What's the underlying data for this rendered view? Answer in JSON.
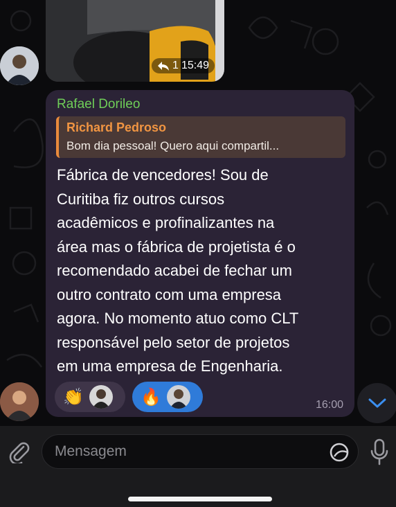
{
  "previous_message": {
    "time": "15:49",
    "forward_count": "1"
  },
  "message": {
    "sender": "Rafael Dorileo",
    "reply_to": {
      "author": "Richard Pedroso",
      "snippet": "Bom dia pessoal! Quero aqui compartil..."
    },
    "lines": [
      "Fábrica de vencedores!  Sou de",
      "Curitiba fiz outros cursos",
      "acadêmicos e profinalizantes na",
      "área mas o fábrica de projetista é o",
      "recomendado acabei de fechar um",
      "outro contrato com uma empresa",
      "agora. No momento atuo como CLT",
      "responsável pelo setor de projetos",
      "em uma empresa de Engenharia."
    ],
    "time": "16:00",
    "reactions": [
      {
        "emoji": "👏",
        "selected": false
      },
      {
        "emoji": "🔥",
        "selected": true
      }
    ]
  },
  "composer": {
    "placeholder": "Mensagem"
  },
  "colors": {
    "sender": "#6fce58",
    "reply_author": "#f19542",
    "bubble": "#2b2336",
    "selected_reaction": "#2f7bd9"
  },
  "icons": [
    "attach-icon",
    "sticker-icon",
    "mic-icon",
    "chevron-down-icon",
    "reply-forward-icon"
  ]
}
